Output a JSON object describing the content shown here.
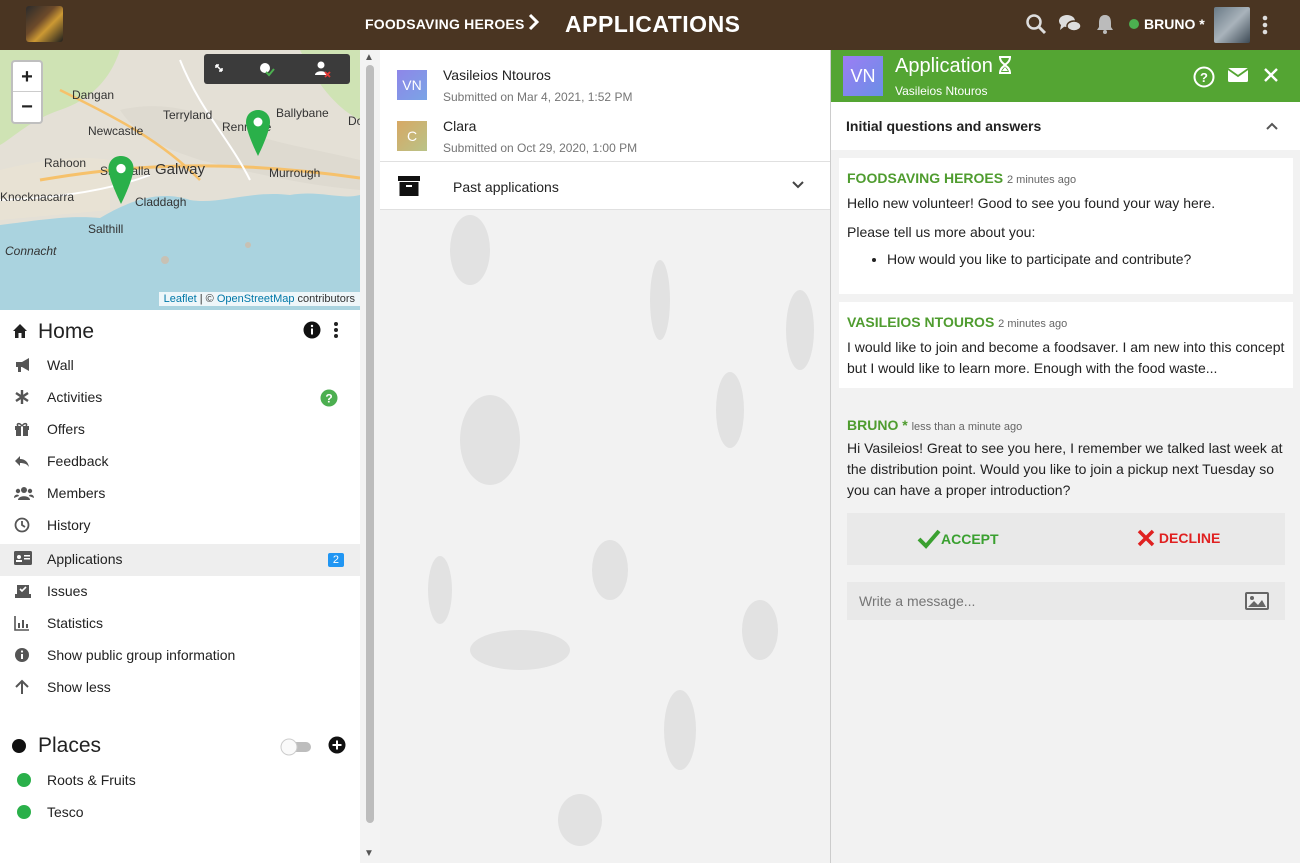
{
  "topbar": {
    "group_name": "FOODSAVING HEROES",
    "separator": "›",
    "page_title": "APPLICATIONS",
    "user_name": "BRUNO *"
  },
  "map": {
    "zoom_in": "+",
    "zoom_out": "−",
    "places": [
      "Dangan",
      "Terryland",
      "Ballybane",
      "Newcastle",
      "Galway",
      "Rahoon",
      "Shantalla",
      "Claddagh",
      "Renmore",
      "Murrough",
      "Salthill",
      "Knocknacarra",
      "Connacht",
      "Do"
    ],
    "attribution": {
      "leaflet": "Leaflet",
      "sep": " | © ",
      "osm": "OpenStreetMap",
      "tail": " contributors"
    }
  },
  "sidebar": {
    "home_title": "Home",
    "items": [
      {
        "label": "Wall",
        "icon": "megaphone-icon"
      },
      {
        "label": "Activities",
        "icon": "asterisk-icon"
      },
      {
        "label": "Offers",
        "icon": "gift-icon"
      },
      {
        "label": "Feedback",
        "icon": "reply-icon"
      },
      {
        "label": "Members",
        "icon": "users-icon"
      },
      {
        "label": "History",
        "icon": "clock-icon"
      },
      {
        "label": "Applications",
        "icon": "id-card-icon",
        "badge": "2"
      },
      {
        "label": "Issues",
        "icon": "vote-icon"
      },
      {
        "label": "Statistics",
        "icon": "bar-chart-icon"
      },
      {
        "label": "Show public group information",
        "icon": "info-icon"
      },
      {
        "label": "Show less",
        "icon": "arrow-up-icon"
      }
    ],
    "places_title": "Places",
    "places": [
      "Roots & Fruits",
      "Tesco"
    ]
  },
  "applications": [
    {
      "initials": "VN",
      "name": "Vasileios Ntouros",
      "submitted": "Submitted on Mar 4, 2021, 1:52 PM",
      "color": "#8e86e8"
    },
    {
      "initials": "C",
      "name": "Clara",
      "submitted": "Submitted on Oct 29, 2020, 1:00 PM",
      "color": "#d7a864"
    }
  ],
  "past_applications_label": "Past applications",
  "panel": {
    "avatar_initials": "VN",
    "title": "Application",
    "subtitle": "Vasileios Ntouros",
    "qa_header": "Initial questions and answers",
    "question": {
      "author": "FOODSAVING HEROES",
      "time": "2 minutes ago",
      "greeting": "Hello new volunteer! Good to see you found your way here.",
      "prompt": "Please tell us more about you:",
      "bullet": "How would you like to participate and contribute?"
    },
    "answer": {
      "author": "VASILEIOS NTOUROS",
      "time": "2 minutes ago",
      "text": "I would like to join and become a foodsaver. I am new into this concept but I would like to learn more. Enough with the food waste..."
    },
    "message": {
      "author": "BRUNO *",
      "time": "less than a minute ago",
      "text": "Hi Vasileios! Great to see you here, I remember we talked last week at the distribution point. Would you like to join a pickup next Tuesday so you can have a proper introduction?"
    },
    "accept_label": "ACCEPT",
    "decline_label": "DECLINE",
    "compose_placeholder": "Write a message..."
  },
  "colors": {
    "topbar": "#4a3522",
    "accent_green": "#54a533",
    "decline_red": "#e02121",
    "badge_blue": "#2196f3"
  }
}
